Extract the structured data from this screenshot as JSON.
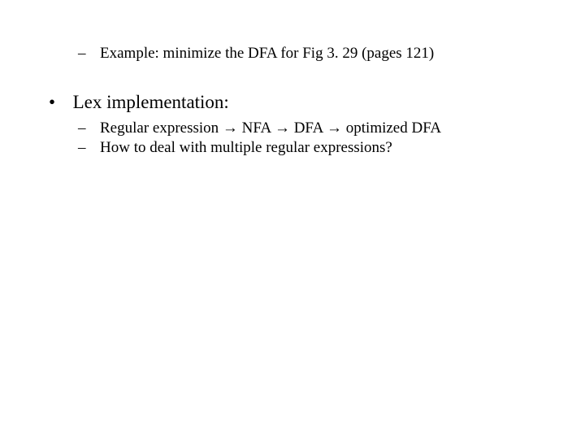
{
  "bullets": {
    "example": {
      "prefix": "–",
      "text": "Example: minimize the DFA for Fig 3. 29 (pages 121)"
    },
    "lex": {
      "prefix": "•",
      "text": "Lex implementation:"
    },
    "pipeline": {
      "prefix": "–",
      "text": "Regular expression → NFA → DFA → optimized DFA"
    },
    "howto": {
      "prefix": "–",
      "text": "How to deal with multiple regular expressions?"
    }
  }
}
